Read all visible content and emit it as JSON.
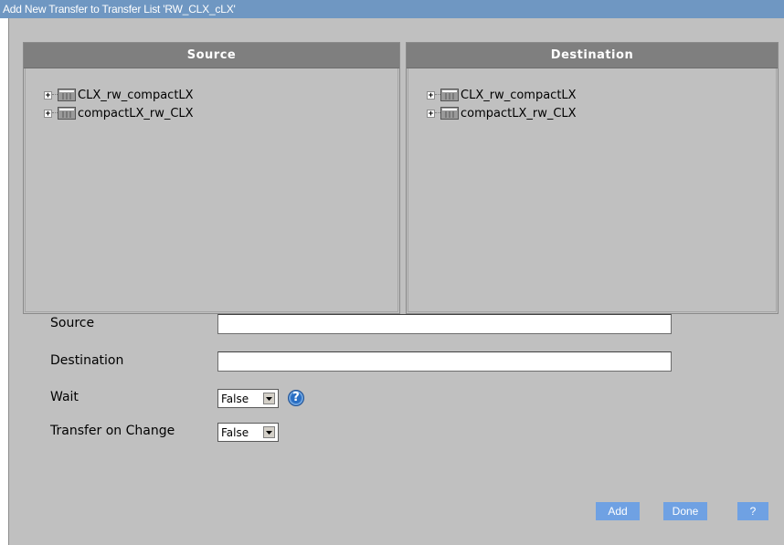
{
  "window": {
    "title": "Add New Transfer to Transfer List 'RW_CLX_cLX'"
  },
  "source_panel": {
    "header": "Source",
    "nodes": [
      {
        "expander": "+",
        "label": "CLX_rw_compactLX",
        "icon": "database-icon"
      },
      {
        "expander": "+",
        "label": "compactLX_rw_CLX",
        "icon": "database-icon"
      }
    ]
  },
  "destination_panel": {
    "header": "Destination",
    "nodes": [
      {
        "expander": "+",
        "label": "CLX_rw_compactLX",
        "icon": "database-icon"
      },
      {
        "expander": "+",
        "label": "compactLX_rw_CLX",
        "icon": "database-icon"
      }
    ]
  },
  "form": {
    "source_label": "Source",
    "source_value": "",
    "destination_label": "Destination",
    "destination_value": "",
    "wait_label": "Wait",
    "wait_value": "False",
    "transfer_on_change_label": "Transfer on Change",
    "transfer_on_change_value": "False",
    "help_icon": "?"
  },
  "buttons": {
    "add": "Add",
    "done": "Done",
    "help": "?"
  },
  "colors": {
    "titlebar": "#6f97c2",
    "dialog_bg": "#c0c0c0",
    "panel_header": "#7f7f7f",
    "button": "#6fa1e3"
  }
}
